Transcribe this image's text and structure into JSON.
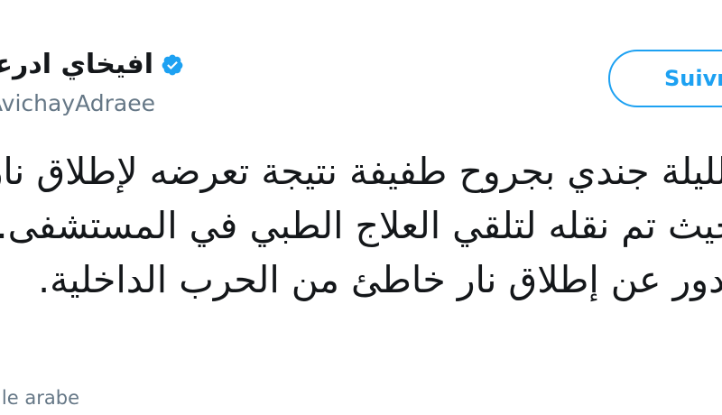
{
  "author": {
    "display_name": "افيخاي ادرعي",
    "handle": "@AvichayAdraee",
    "verified": true
  },
  "follow_button": {
    "label": "Suivre"
  },
  "tweet": {
    "lines": [
      "الليلة جندي بجروح طفيفة نتيجة تعرضه لإطلاق نار",
      "حيث تم نقله لتلقي العلاج الطبي في المستشفى. كما",
      "يدور عن إطلاق نار خاطئ من الحرب الداخلية."
    ]
  },
  "translate": {
    "label": "Traduire depuis le arabe"
  },
  "colors": {
    "accent": "#1da1f2",
    "text": "#14171a",
    "muted": "#657786",
    "background": "#ffffff"
  },
  "icons": {
    "verified": "verified-badge-icon"
  }
}
